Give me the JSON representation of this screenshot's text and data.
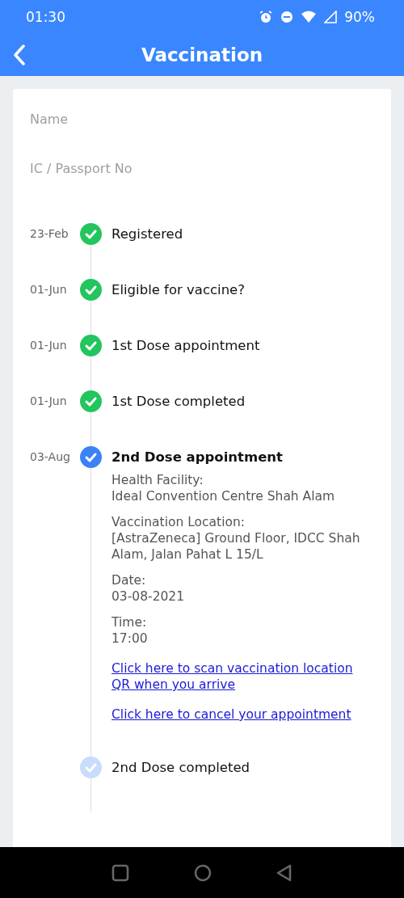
{
  "status_bar": {
    "time": "01:30",
    "battery": "90%"
  },
  "header": {
    "title": "Vaccination"
  },
  "profile": {
    "fields": [
      {
        "label": "Name"
      },
      {
        "label": "IC / Passport No"
      }
    ]
  },
  "timeline": [
    {
      "date": "23-Feb",
      "title": "Registered",
      "kind": "done"
    },
    {
      "date": "01-Jun",
      "title": "Eligible for vaccine?",
      "kind": "done"
    },
    {
      "date": "01-Jun",
      "title": "1st Dose appointment",
      "kind": "done"
    },
    {
      "date": "01-Jun",
      "title": "1st Dose completed",
      "kind": "done"
    },
    {
      "date": "03-Aug",
      "title": "2nd Dose appointment",
      "kind": "current",
      "details": [
        {
          "label": "Health Facility:",
          "value": "Ideal Convention Centre Shah Alam"
        },
        {
          "label": "Vaccination Location:",
          "value": "[AstraZeneca] Ground Floor, IDCC Shah Alam, Jalan Pahat L 15/L"
        },
        {
          "label": "Date:",
          "value": "03-08-2021"
        },
        {
          "label": "Time:",
          "value": "17:00"
        }
      ],
      "links": [
        "Click here to scan vaccination location QR when you arrive",
        "Click here to cancel your appointment"
      ]
    },
    {
      "title": "2nd Dose completed",
      "kind": "pending"
    }
  ]
}
